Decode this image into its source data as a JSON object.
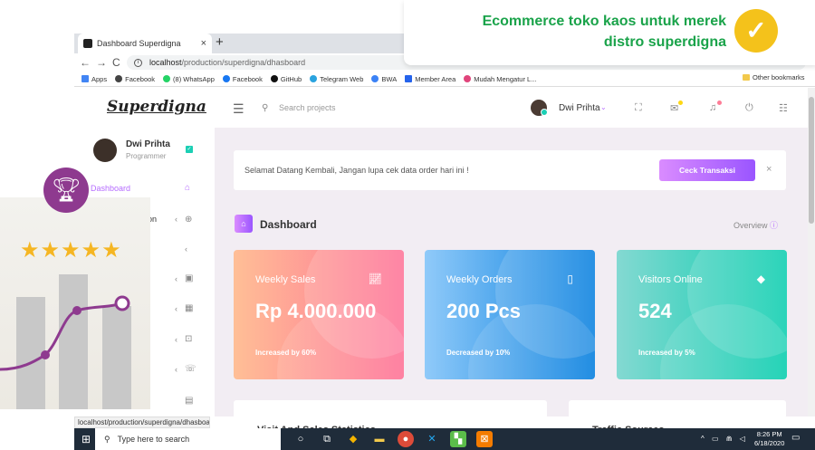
{
  "browser": {
    "tab_title": "Dashboard Superdigna",
    "url_host": "localhost",
    "url_path": "/production/superdigna/dhasboard",
    "bookmarks": [
      "Apps",
      "Facebook",
      "(8) WhatsApp",
      "Facebook",
      "GitHub",
      "Telegram Web",
      "BWA",
      "Member Area",
      "Mudah Mengatur L..."
    ],
    "other_bookmarks": "Other bookmarks",
    "status_url": "localhost/production/superdigna/dhasboard#"
  },
  "banner": {
    "line1": "Ecommerce toko kaos untuk merek",
    "line2": "distro superdigna"
  },
  "app": {
    "logo": "Superdigna",
    "search_placeholder": "Search projects",
    "user_name": "Dwi Prihta",
    "sidebar": {
      "name": "Dwi Prihta",
      "role": "Programmer",
      "active_item": "Dashboard",
      "item_partial": "on"
    },
    "welcome": {
      "message": "Selamat Datang Kembali, Jangan lupa cek data order hari ini !",
      "button": "Ceck Transaksi",
      "close": "×"
    },
    "page_title": "Dashboard",
    "overview": "Overview",
    "cards": [
      {
        "title": "Weekly Sales",
        "value": "Rp 4.000.000",
        "footer": "Increased by 60%",
        "icon": "chart-line-icon"
      },
      {
        "title": "Weekly Orders",
        "value": "200 Pcs",
        "footer": "Decreased by 10%",
        "icon": "bookmark-icon"
      },
      {
        "title": "Visitors Online",
        "value": "524",
        "footer": "Increased by 5%",
        "icon": "diamond-icon"
      }
    ],
    "panel_left_title": "Visit And Sales Statistics",
    "panel_right_title": "Traffic Sources"
  },
  "taskbar": {
    "search": "Type here to search",
    "time": "8:26 PM",
    "date": "6/18/2020"
  },
  "colors": {
    "accent": "#b66dff",
    "sales": "#ff8c6b",
    "orders": "#47b4f5",
    "visitors": "#1fd1b1",
    "banner_text": "#1aa34a",
    "badge": "#f4c21b",
    "trophy": "#8e3a8f"
  }
}
